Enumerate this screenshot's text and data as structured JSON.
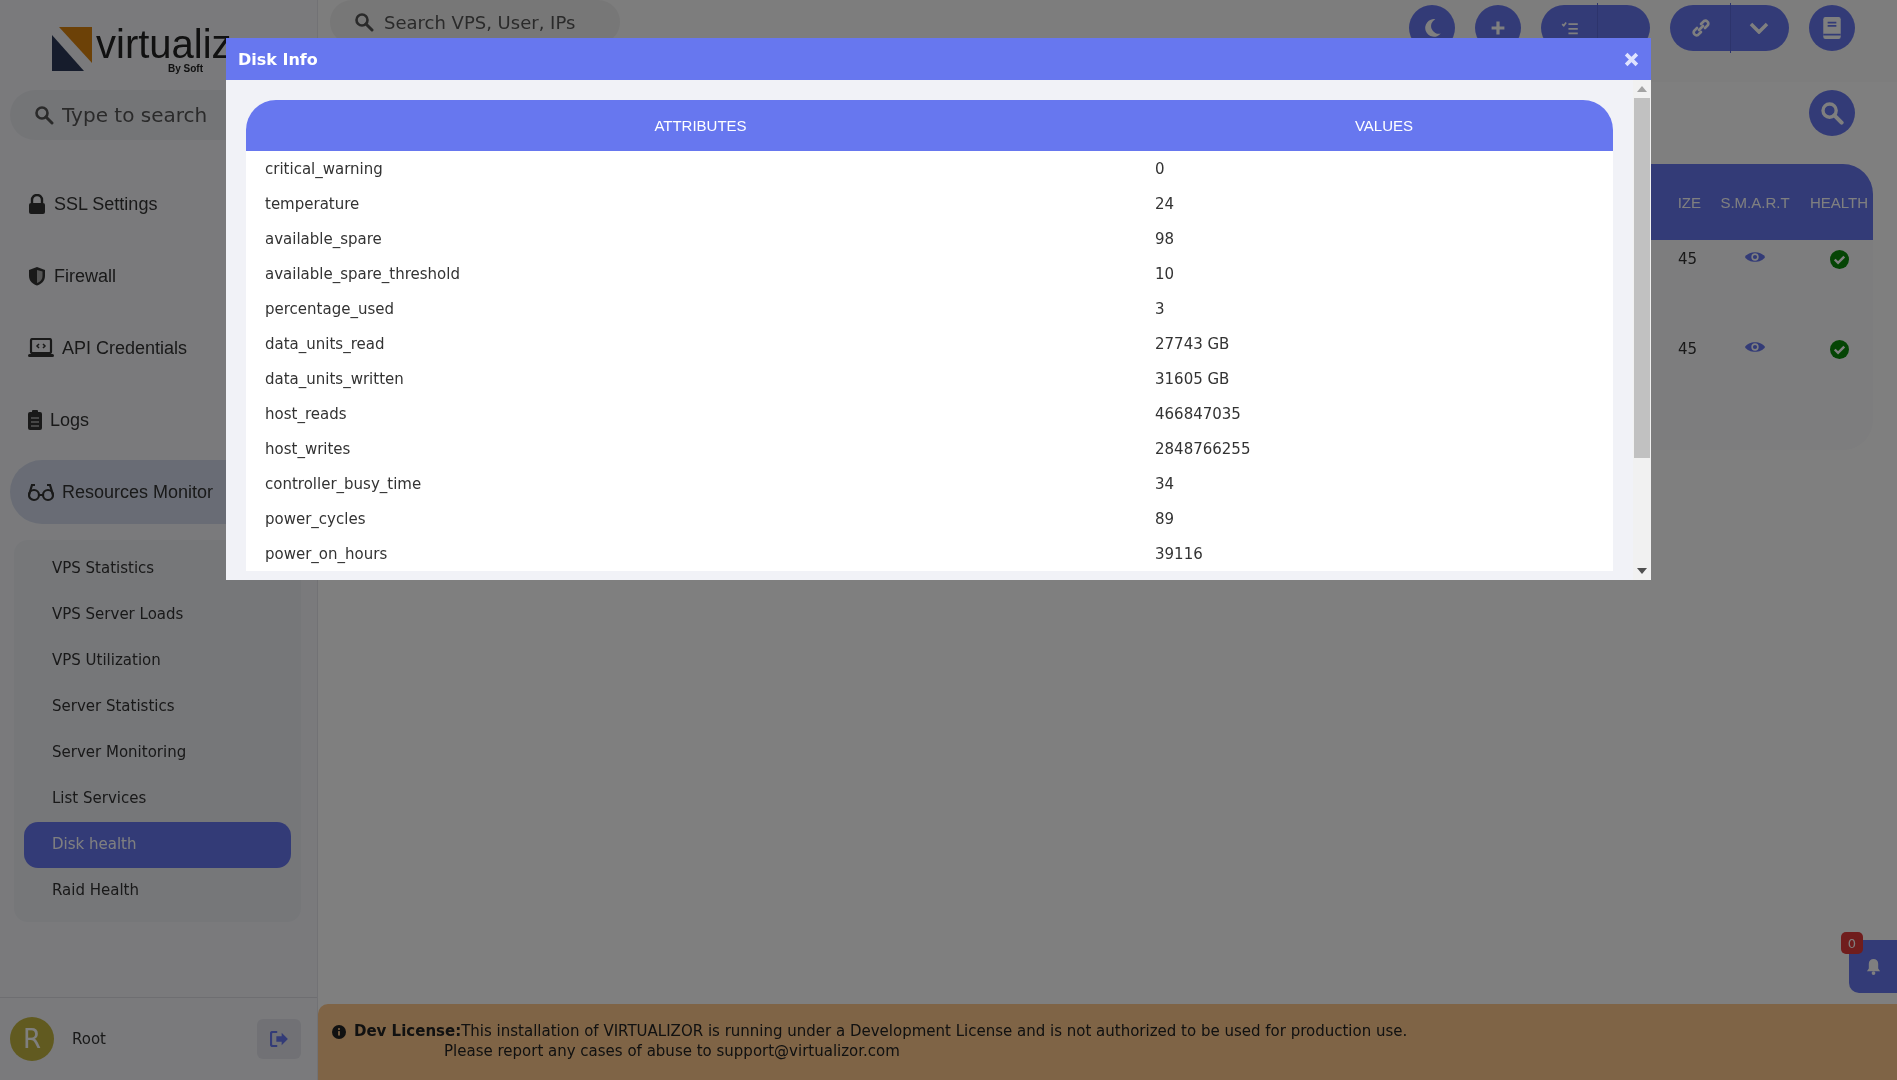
{
  "brand": {
    "name": "virtualiz",
    "tagline": "By Soft"
  },
  "sidebar": {
    "search": {
      "placeholder": "Type to search"
    },
    "items": [
      {
        "label": "SSL Settings",
        "selected": false
      },
      {
        "label": "Firewall",
        "selected": false
      },
      {
        "label": "API Credentials",
        "selected": false
      },
      {
        "label": "Logs",
        "selected": false
      },
      {
        "label": "Resources Monitor",
        "selected": true,
        "children": [
          {
            "label": "VPS Statistics",
            "selected": false
          },
          {
            "label": "VPS Server Loads",
            "selected": false
          },
          {
            "label": "VPS Utilization",
            "selected": false
          },
          {
            "label": "Server Statistics",
            "selected": false
          },
          {
            "label": "Server Monitoring",
            "selected": false
          },
          {
            "label": "List Services",
            "selected": false
          },
          {
            "label": "Disk health",
            "selected": true
          },
          {
            "label": "Raid Health",
            "selected": false
          }
        ]
      }
    ]
  },
  "user": {
    "initial": "R",
    "name": "Root"
  },
  "topbar": {
    "search": {
      "placeholder": "Search VPS, User, IPs"
    }
  },
  "disk_table": {
    "columns": [
      "IZE",
      "S.M.A.R.T",
      "HEALTH"
    ],
    "rows": [
      {
        "size": "45",
        "healthy": true
      },
      {
        "size": "45",
        "healthy": true
      }
    ]
  },
  "notifications": {
    "count": "0"
  },
  "license_notice": {
    "label": "Dev License:",
    "lines": [
      "This installation of VIRTUALIZOR is running under a Development License and is not authorized to be used for production use.",
      "Please report any cases of abuse to support@virtualizor.com"
    ]
  },
  "modal": {
    "title": "Disk Info",
    "columns": [
      "ATTRIBUTES",
      "VALUES"
    ],
    "rows": [
      {
        "attribute": "critical_warning",
        "value": "0"
      },
      {
        "attribute": "temperature",
        "value": "24"
      },
      {
        "attribute": "available_spare",
        "value": "98"
      },
      {
        "attribute": "available_spare_threshold",
        "value": "10"
      },
      {
        "attribute": "percentage_used",
        "value": "3"
      },
      {
        "attribute": "data_units_read",
        "value": "27743 GB"
      },
      {
        "attribute": "data_units_written",
        "value": "31605 GB"
      },
      {
        "attribute": "host_reads",
        "value": "466847035"
      },
      {
        "attribute": "host_writes",
        "value": "2848766255"
      },
      {
        "attribute": "controller_busy_time",
        "value": "34"
      },
      {
        "attribute": "power_cycles",
        "value": "89"
      },
      {
        "attribute": "power_on_hours",
        "value": "39116"
      }
    ]
  }
}
